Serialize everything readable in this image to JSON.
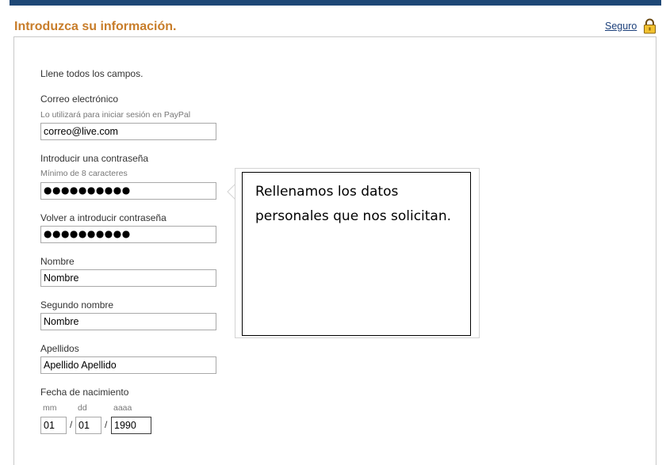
{
  "header": {
    "title": "Introduzca su información.",
    "secure_link": "Seguro",
    "lock_icon": "padlock-icon"
  },
  "form": {
    "intro": "Llene todos los campos.",
    "email": {
      "label": "Correo electrónico",
      "hint": "Lo utilizará para iniciar sesión en PayPal",
      "value": "correo@live.com"
    },
    "password": {
      "label": "Introducir una contraseña",
      "hint": "Mínimo de 8 caracteres",
      "value": "●●●●●●●●●●"
    },
    "password_confirm": {
      "label": "Volver a introducir contraseña",
      "value": "●●●●●●●●●●"
    },
    "first_name": {
      "label": "Nombre",
      "value": "Nombre"
    },
    "middle_name": {
      "label": "Segundo nombre",
      "value": "Nombre"
    },
    "last_name": {
      "label": "Apellidos",
      "value": "Apellido Apellido"
    },
    "birthdate": {
      "label": "Fecha de nacimiento",
      "month_hint": "mm",
      "day_hint": "dd",
      "year_hint": "aaaa",
      "separator": "/",
      "month": "01",
      "day": "01",
      "year": "1990"
    }
  },
  "callout": {
    "text": "Rellenamos los datos personales que nos solicitan."
  },
  "colors": {
    "topbar": "#1e4876",
    "title": "#c87d2a",
    "link": "#1b3f7a"
  }
}
